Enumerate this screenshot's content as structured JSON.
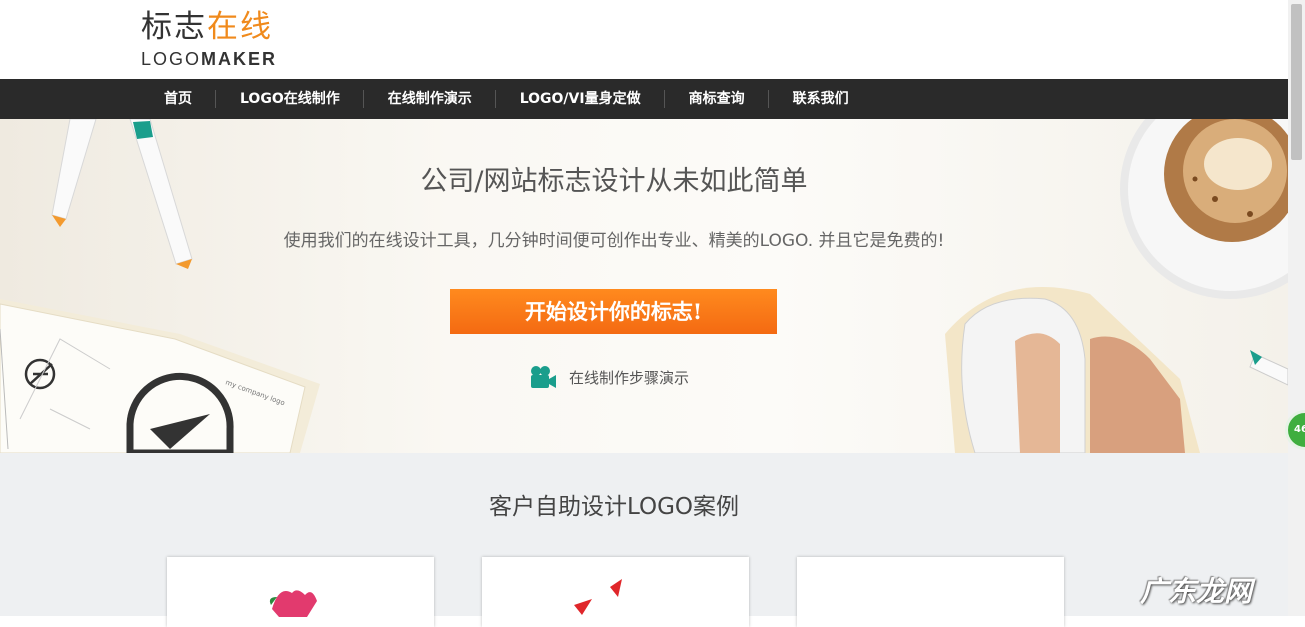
{
  "logo": {
    "cn_main": "标志",
    "cn_accent": "在线",
    "en_light": "LOGO",
    "en_bold": "MAKER"
  },
  "nav": {
    "items": [
      {
        "label": "首页"
      },
      {
        "label": "LOGO在线制作"
      },
      {
        "label": "在线制作演示"
      },
      {
        "label": "LOGO/VI量身定做"
      },
      {
        "label": "商标查询"
      },
      {
        "label": "联系我们"
      }
    ]
  },
  "hero": {
    "title": "公司/网站标志设计从未如此简单",
    "subtitle": "使用我们的在线设计工具，几分钟时间便可创作出专业、精美的LOGO. 并且它是免费的!",
    "cta_label": "开始设计你的标志!",
    "demo_label": "在线制作步骤演示",
    "sketch_note": "my company logo"
  },
  "cases": {
    "title": "客户自助设计LOGO案例"
  },
  "side_badge": "46",
  "watermark": "广东龙网",
  "colors": {
    "accent": "#f08a1c",
    "nav_bg": "#2a2a2a",
    "cta": "#f46a12",
    "teal": "#1a9e8c"
  }
}
